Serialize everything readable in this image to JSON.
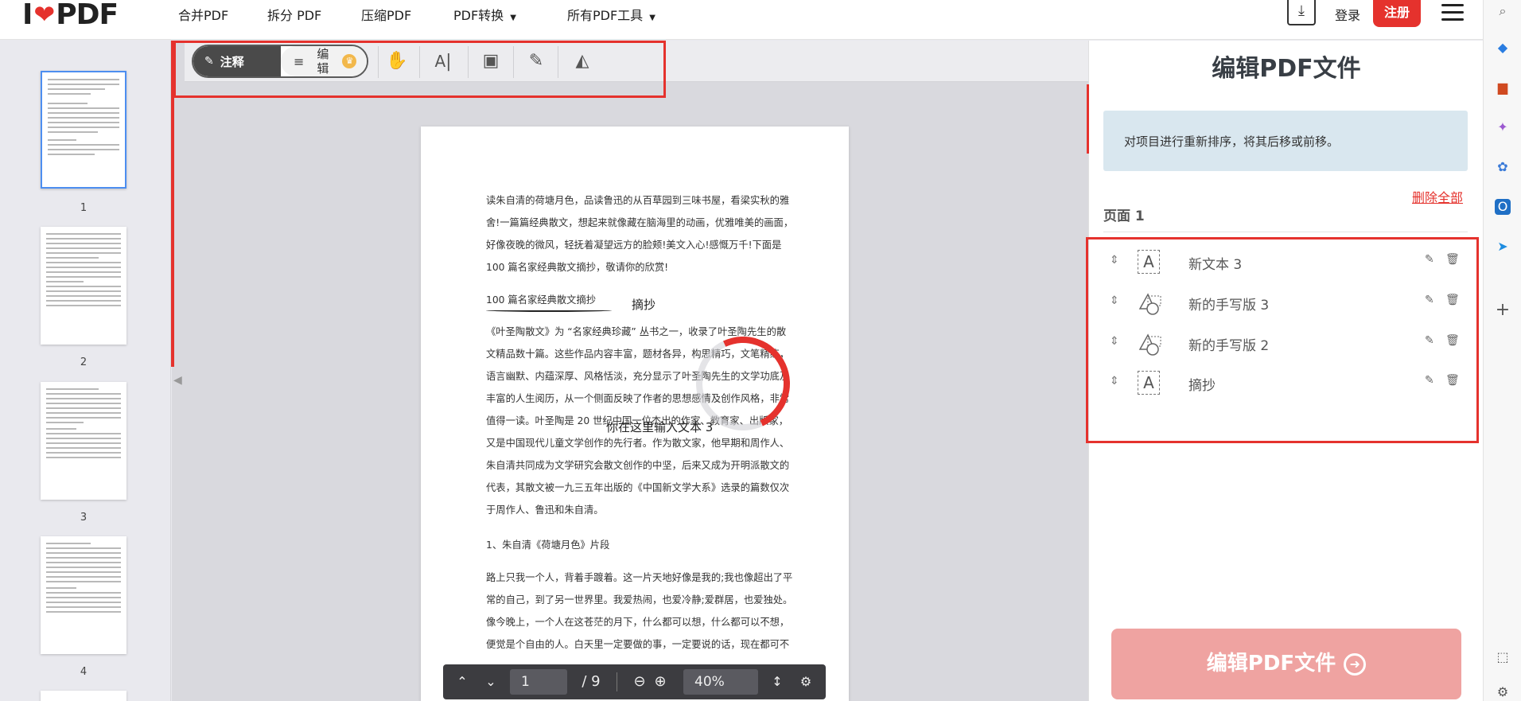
{
  "nav": {
    "logo_i": "I",
    "logo_heart": "❤",
    "logo_pdf": "PDF",
    "items": [
      {
        "label": "合并PDF"
      },
      {
        "label": "拆分 PDF"
      },
      {
        "label": "压缩PDF"
      },
      {
        "label": "PDF转换"
      },
      {
        "label": "所有PDF工具"
      }
    ],
    "login": "登录",
    "signup": "注册"
  },
  "toolbar": {
    "annotate": "注释",
    "edit": "编辑"
  },
  "thumbnails": [
    {
      "num": "1"
    },
    {
      "num": "2"
    },
    {
      "num": "3"
    },
    {
      "num": "4"
    }
  ],
  "document": {
    "para1": "读朱自清的荷塘月色，品读鲁迅的从百草园到三味书屋，看梁实秋的雅\n舍!一篇篇经典散文，想起来就像藏在脑海里的动画，优雅唯美的画面，\n好像夜晚的微风，轻抚着凝望远方的脸颊!美文入心!感慨万千!下面是\n100 篇名家经典散文摘抄，敬请你的欣赏!",
    "heading": "100 篇名家经典散文摘抄",
    "annot_excerpt": "摘抄",
    "para2": "《叶圣陶散文》为 “名家经典珍藏” 丛书之一，收录了叶圣陶先生的散\n文精品数十篇。这些作品内容丰富，题材各异，构思精巧，文笔精练，\n语言幽默、内蕴深厚、风格恬淡，充分显示了叶圣陶先生的文学功底及\n丰富的人生阅历，从一个侧面反映了作者的思想感情及创作风格，非常\n值得一读。叶圣陶是 20 世纪中国一位杰出的作家、教育家、出版家，\n又是中国现代儿童文学创作的先行者。作为散文家，他早期和周作人、\n朱自清共同成为文学研究会散文创作的中坚，后来又成为开明派散文的\n代表，其散文被一九三五年出版的《中国新文学大系》选录的篇数仅次\n于周作人、鲁迅和朱自清。",
    "section1": "1、朱自清《荷塘月色》片段",
    "para3": "路上只我一个人，背着手踱着。这一片天地好像是我的;我也像超出了平\n常的自己，到了另一世界里。我爱热闹，也爱冷静;爱群居，也爱独处。\n像今晚上，一个人在这苍茫的月下，什么都可以想，什么都可以不想，\n便觉是个自由的人。白天里一定要做的事，一定要说的话，现在都可不",
    "annot_placeholder": "你在这里输入文本 3"
  },
  "pager": {
    "current": "1",
    "total": "/ 9",
    "zoom": "40%"
  },
  "panel": {
    "title": "编辑PDF文件",
    "info": "对项目进行重新排序，将其后移或前移。",
    "delete_all": "删除全部",
    "page_label": "页面 1",
    "items": [
      {
        "label": "新文本 3",
        "kind": "text"
      },
      {
        "label": "新的手写版 3",
        "kind": "freehand"
      },
      {
        "label": "新的手写版 2",
        "kind": "freehand"
      },
      {
        "label": "摘抄",
        "kind": "text"
      }
    ],
    "submit": "编辑PDF文件"
  },
  "colors": {
    "brand_red": "#e5322d",
    "info_bg": "#d9e7ef",
    "submit_disabled": "#efa3a1"
  }
}
